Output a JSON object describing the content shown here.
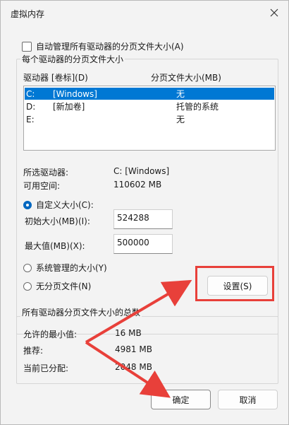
{
  "window": {
    "title": "虚拟内存"
  },
  "auto_manage": {
    "label": "自动管理所有驱动器的分页文件大小(A)"
  },
  "per_drive": {
    "group_label": "每个驱动器的分页文件大小",
    "col_drive": "驱动器 [卷标](D)",
    "col_size": "分页文件大小(MB)",
    "drives": [
      {
        "drive": "C:",
        "label": "[Windows]",
        "size": "无"
      },
      {
        "drive": "D:",
        "label": "[新加卷]",
        "size": "托管的系统"
      },
      {
        "drive": "E:",
        "label": "",
        "size": "无"
      }
    ],
    "selected_drive_label": "所选驱动器:",
    "selected_drive_value": "C:  [Windows]",
    "free_space_label": "可用空间:",
    "free_space_value": "110602 MB",
    "custom_size_label": "自定义大小(C):",
    "initial_size_label": "初始大小(MB)(I):",
    "initial_size_value": "524288",
    "max_size_label": "最大值(MB)(X):",
    "max_size_value": "500000",
    "system_managed_label": "系统管理的大小(Y)",
    "no_paging_label": "无分页文件(N)",
    "set_button": "设置(S)"
  },
  "totals": {
    "group_label": "所有驱动器分页文件大小的总数",
    "min_label": "允许的最小值:",
    "min_value": "16 MB",
    "recommended_label": "推荐:",
    "recommended_value": "4981 MB",
    "allocated_label": "当前已分配:",
    "allocated_value": "2048 MB"
  },
  "buttons": {
    "ok": "确定",
    "cancel": "取消"
  },
  "colors": {
    "selection": "#0078d4",
    "highlight": "#e8403a",
    "accent": "#0067c0"
  }
}
